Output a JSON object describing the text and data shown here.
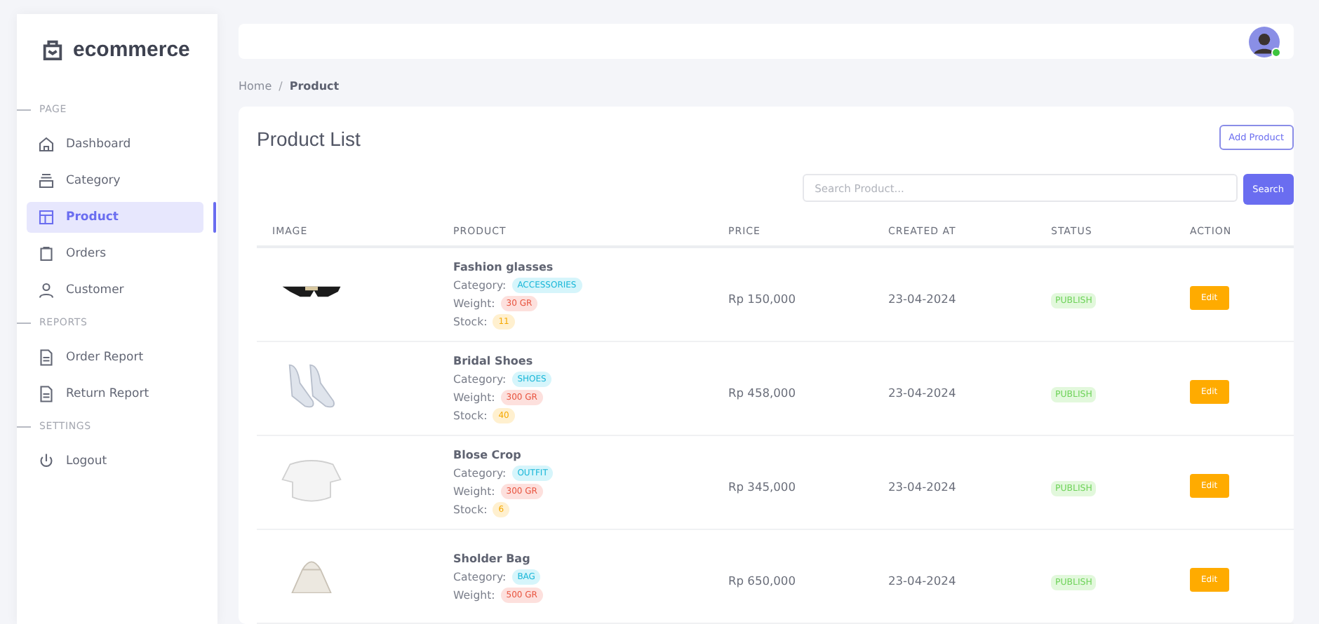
{
  "brand": {
    "name": "ecommerce"
  },
  "sidebar": {
    "sections": [
      {
        "title": "PAGE",
        "items": [
          {
            "label": "Dashboard",
            "kind": "home",
            "selected": false
          },
          {
            "label": "Category",
            "kind": "stack",
            "selected": false
          },
          {
            "label": "Product",
            "kind": "layout",
            "selected": true
          },
          {
            "label": "Orders",
            "kind": "clipboard",
            "selected": false
          },
          {
            "label": "Customer",
            "kind": "user",
            "selected": false
          }
        ]
      },
      {
        "title": "REPORTS",
        "items": [
          {
            "label": "Order Report",
            "kind": "file",
            "selected": false
          },
          {
            "label": "Return Report",
            "kind": "file",
            "selected": false
          }
        ]
      },
      {
        "title": "SETTINGS",
        "items": [
          {
            "label": "Logout",
            "kind": "power",
            "selected": false
          }
        ]
      }
    ]
  },
  "header": {
    "avatar": {
      "online": true
    }
  },
  "breadcrumb": {
    "separator": "/",
    "items": [
      {
        "label": "Home",
        "current": false
      },
      {
        "label": "Product",
        "current": true
      }
    ]
  },
  "card": {
    "title": "Product List",
    "add_button": "Add Product",
    "search": {
      "placeholder": "Search Product...",
      "button": "Search"
    }
  },
  "table": {
    "columns": [
      "IMAGE",
      "PRODUCT",
      "PRICE",
      "CREATED AT",
      "STATUS",
      "ACTION"
    ],
    "rows": [
      {
        "kind": "glasses",
        "name": "Fashion glasses",
        "details": [
          {
            "label": "Category:",
            "value": "ACCESSORIES",
            "kind": "category"
          },
          {
            "label": "Weight:",
            "value": "30 GR",
            "kind": "weight"
          },
          {
            "label": "Stock:",
            "value": "11",
            "kind": "stock"
          }
        ],
        "price": "Rp 150,000",
        "created_at": "23-04-2024",
        "status": "PUBLISH",
        "action": "Edit"
      },
      {
        "kind": "shoes",
        "name": "Bridal Shoes",
        "details": [
          {
            "label": "Category:",
            "value": "SHOES",
            "kind": "category"
          },
          {
            "label": "Weight:",
            "value": "300 GR",
            "kind": "weight"
          },
          {
            "label": "Stock:",
            "value": "40",
            "kind": "stock"
          }
        ],
        "price": "Rp 458,000",
        "created_at": "23-04-2024",
        "status": "PUBLISH",
        "action": "Edit"
      },
      {
        "kind": "top",
        "name": "Blose Crop",
        "details": [
          {
            "label": "Category:",
            "value": "OUTFIT",
            "kind": "category"
          },
          {
            "label": "Weight:",
            "value": "300 GR",
            "kind": "weight"
          },
          {
            "label": "Stock:",
            "value": "6",
            "kind": "stock"
          }
        ],
        "price": "Rp 345,000",
        "created_at": "23-04-2024",
        "status": "PUBLISH",
        "action": "Edit"
      },
      {
        "kind": "bag",
        "name": "Sholder Bag",
        "details": [
          {
            "label": "Category:",
            "value": "BAG",
            "kind": "category"
          },
          {
            "label": "Weight:",
            "value": "500 GR",
            "kind": "weight"
          }
        ],
        "price": "Rp 650,000",
        "created_at": "23-04-2024",
        "status": "PUBLISH",
        "action": "Edit"
      }
    ]
  }
}
